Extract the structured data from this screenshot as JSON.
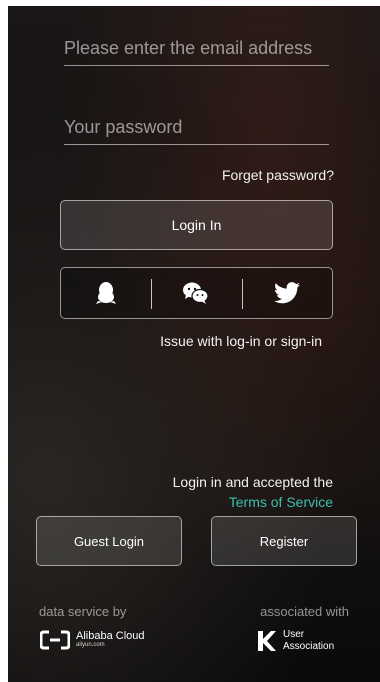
{
  "form": {
    "email_placeholder": "Please enter the email address",
    "password_placeholder": "Your password",
    "forget_password": "Forget password?",
    "login_button": "Login In",
    "issue_link": "Issue with log-in or sign-in"
  },
  "social": {
    "icons": [
      "qq-icon",
      "wechat-icon",
      "twitter-icon"
    ]
  },
  "terms": {
    "prefix": "Login in and accepted the",
    "link": "Terms of Service",
    "link_color": "#3fbfae"
  },
  "actions": {
    "guest_login": "Guest Login",
    "register": "Register"
  },
  "footer": {
    "data_service_label": "data service by",
    "provider_name": "Alibaba Cloud",
    "provider_domain": "aliyun.com",
    "associated_label": "associated with",
    "association_line1": "User",
    "association_line2": "Association"
  }
}
